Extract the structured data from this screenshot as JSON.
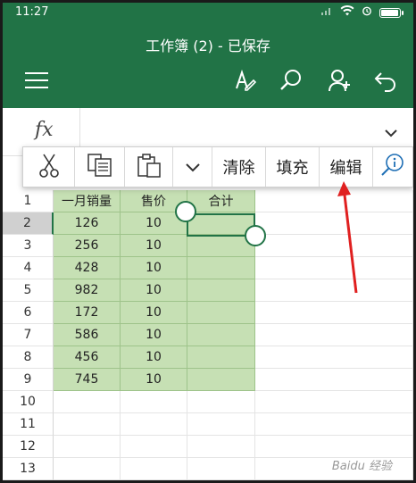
{
  "status_bar": {
    "time": "11:27"
  },
  "app": {
    "title": "工作簿 (2) - 已保存",
    "theme_color": "#217346"
  },
  "toolbar": {
    "icons": [
      "menu-icon",
      "pen-icon",
      "search-icon",
      "share-icon",
      "undo-icon"
    ]
  },
  "formula_bar": {
    "fx_label": "fx"
  },
  "context_menu": {
    "items": [
      {
        "icon": "cut-icon"
      },
      {
        "icon": "copy-icon"
      },
      {
        "icon": "paste-icon"
      },
      {
        "icon": "chevron-down-icon"
      },
      {
        "label": "清除"
      },
      {
        "label": "填充"
      },
      {
        "label": "编辑"
      },
      {
        "icon": "lookup-icon"
      }
    ]
  },
  "sheet": {
    "row_numbers": [
      "1",
      "2",
      "3",
      "4",
      "5",
      "6",
      "7",
      "8",
      "9",
      "10",
      "11",
      "12",
      "13"
    ],
    "headers": [
      "一月销量",
      "售价",
      "合计"
    ],
    "rows": [
      [
        "126",
        "10",
        ""
      ],
      [
        "256",
        "10",
        ""
      ],
      [
        "428",
        "10",
        ""
      ],
      [
        "982",
        "10",
        ""
      ],
      [
        "172",
        "10",
        ""
      ],
      [
        "586",
        "10",
        ""
      ],
      [
        "456",
        "10",
        ""
      ],
      [
        "745",
        "10",
        ""
      ]
    ],
    "fill_color": "#c6e0b4",
    "selected_cell": "C2"
  },
  "annotation": {
    "arrow_color": "#e02020"
  },
  "watermark": {
    "text": "Baidu 经验"
  }
}
